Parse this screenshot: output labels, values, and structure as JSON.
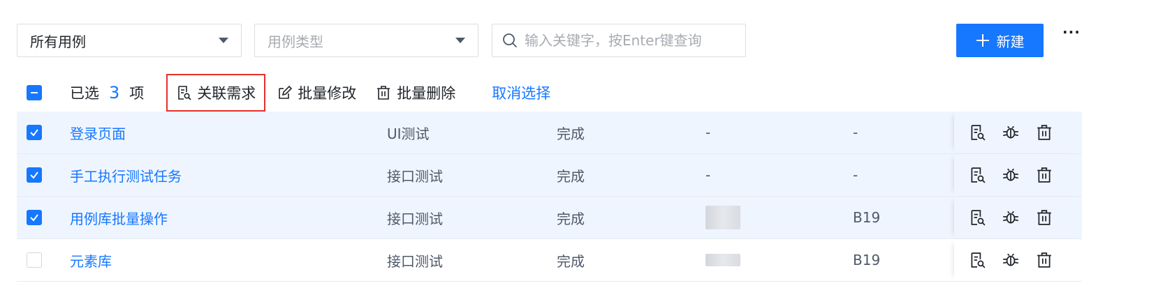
{
  "filters": {
    "scope_select": {
      "value": "所有用例"
    },
    "type_select": {
      "placeholder": "用例类型"
    },
    "search": {
      "placeholder": "输入关键字，按Enter键查询",
      "value": ""
    },
    "new_button": {
      "label": "新建"
    },
    "more_label": "···"
  },
  "toolbar": {
    "selected_prefix": "已选",
    "selected_count": "3",
    "selected_suffix": "项",
    "link_requirement": "关联需求",
    "batch_edit": "批量修改",
    "batch_delete": "批量删除",
    "cancel_selection": "取消选择"
  },
  "rows": [
    {
      "name": "登录页面",
      "type": "UI测试",
      "status": "完成",
      "d1": "-",
      "d2": "-",
      "checked": true
    },
    {
      "name": "手工执行测试任务",
      "type": "接口测试",
      "status": "完成",
      "d1": "-",
      "d2": "-",
      "checked": true
    },
    {
      "name": "用例库批量操作",
      "type": "接口测试",
      "status": "完成",
      "d1": "",
      "d2": "B19",
      "checked": true
    },
    {
      "name": "元素库",
      "type": "接口测试",
      "status": "完成",
      "d1": "",
      "d2": "B19",
      "checked": false
    }
  ],
  "colors": {
    "accent": "#1677ff",
    "highlight_border": "#e5302c",
    "selected_row_bg": "#eff5fe"
  },
  "icons": [
    "search-icon",
    "plus-icon",
    "chevron-down-icon",
    "link-requirement-icon",
    "edit-icon",
    "delete-icon",
    "bug-icon",
    "checkbox-icon"
  ]
}
